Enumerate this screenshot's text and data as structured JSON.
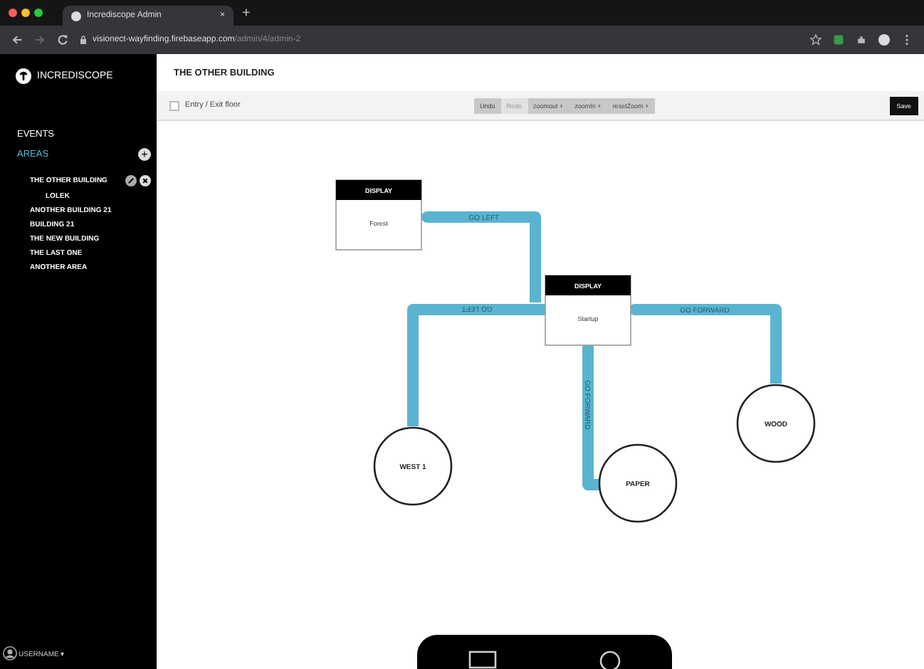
{
  "browser": {
    "tab_title": "Incrediscope Admin",
    "tab_close": "×",
    "new_tab": "+",
    "url_host": "visionect-wayfinding.firebaseapp.com",
    "url_path": "/admin/4/admin-2"
  },
  "sidebar": {
    "brand": "INCREDISCOPE",
    "sections": [
      {
        "label": "EVENTS",
        "selected": false
      },
      {
        "label": "AREAS",
        "selected": true
      }
    ],
    "add_button": "+",
    "areas": [
      {
        "label": "THE OTHER BUILDING",
        "selected": true,
        "children": [
          {
            "label": "LOLEK",
            "selected": false
          }
        ]
      },
      {
        "label": "ANOTHER BUILDING 21",
        "selected": false
      },
      {
        "label": "BUILDING 21",
        "selected": false
      },
      {
        "label": "THE NEW BUILDING",
        "selected": false
      },
      {
        "label": "THE LAST ONE",
        "selected": false
      },
      {
        "label": "ANOTHER AREA",
        "selected": false
      }
    ],
    "user": "USERNAME",
    "user_caret": "▾"
  },
  "main": {
    "title": "THE OTHER BUILDING",
    "toolbar": {
      "checkbox": {
        "label": "Entry / Exit floor",
        "checked": false
      },
      "buttons": [
        {
          "label": "Undo",
          "disabled": false
        },
        {
          "label": "Redo",
          "disabled": true
        },
        {
          "label": "zoomout +",
          "disabled": false
        },
        {
          "label": "zoomIn +",
          "disabled": false
        },
        {
          "label": "resetZoom +",
          "disabled": false
        }
      ],
      "save": "Save"
    },
    "diagram": {
      "nodes": [
        {
          "kind": "display",
          "header": "DISPLAY",
          "label": "Forest"
        },
        {
          "kind": "display",
          "header": "DISPLAY",
          "label": "Startup"
        },
        {
          "kind": "place",
          "label": "WEST 1"
        },
        {
          "kind": "place",
          "label": "PAPER"
        },
        {
          "kind": "place",
          "label": "WOOD"
        }
      ],
      "edges": [
        {
          "label": "GO LEFT"
        },
        {
          "label": "GO LEFT"
        },
        {
          "label": "GO FORWARD"
        },
        {
          "label": "GO FORWARD"
        }
      ]
    }
  }
}
